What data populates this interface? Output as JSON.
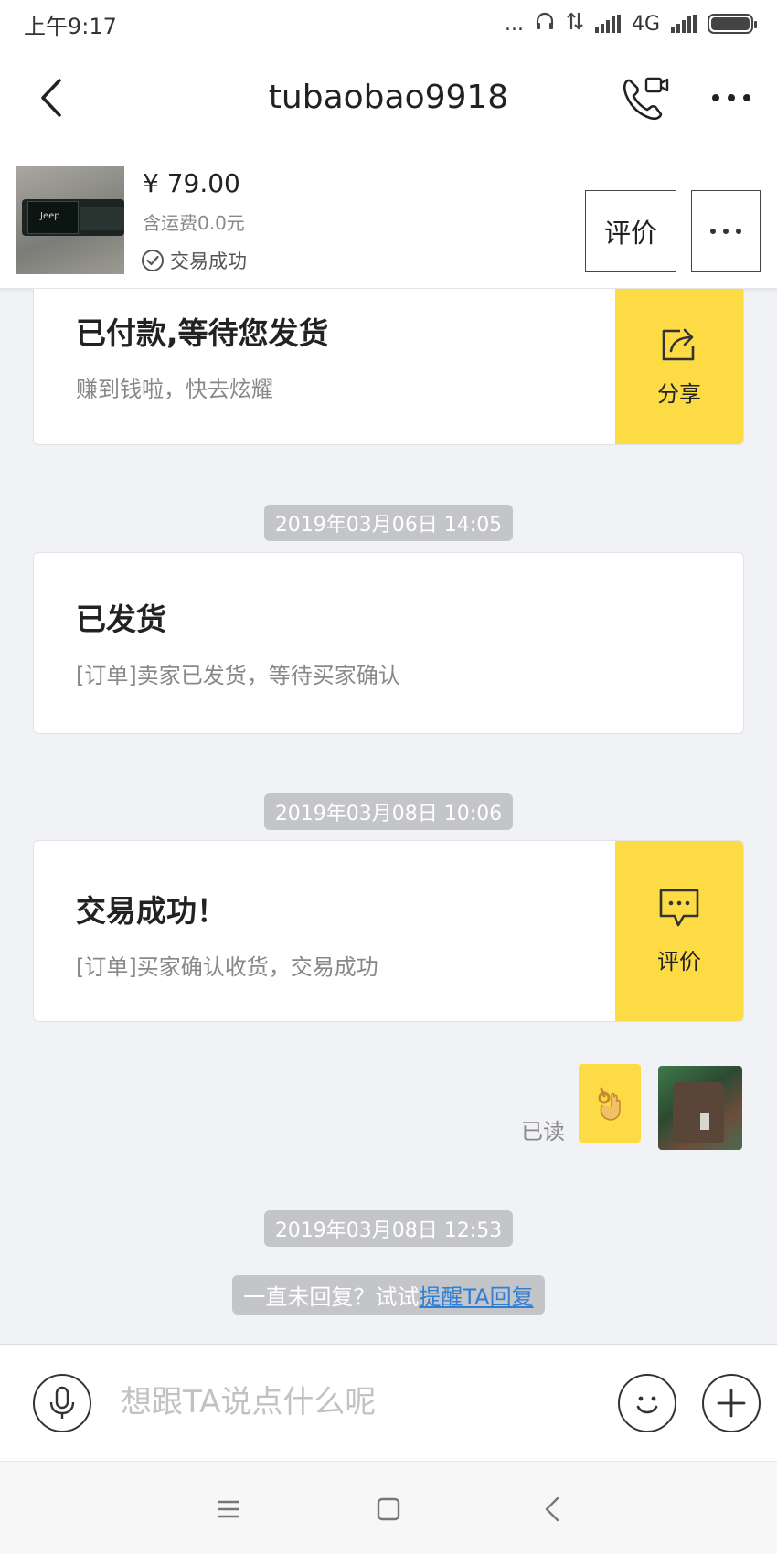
{
  "status_bar": {
    "time": "上午9:17",
    "network": "4G",
    "dots": "..."
  },
  "header": {
    "title": "tubaobao9918",
    "icons": [
      "back-arrow-icon",
      "video-call-icon",
      "more-icon"
    ]
  },
  "product": {
    "price": "¥ 79.00",
    "shipping": "含运费0.0元",
    "status": "交易成功",
    "review_button": "评价",
    "thumb_logo": "Jeep"
  },
  "messages": [
    {
      "title": "已付款,等待您发货",
      "subtitle": "赚到钱啦，快去炫耀",
      "action_label": "分享",
      "action_icon": "share-icon"
    },
    {
      "timestamp": "2019年03月06日 14:05",
      "title": "已发货",
      "subtitle": "[订单]卖家已发货，等待买家确认"
    },
    {
      "timestamp": "2019年03月08日 10:06",
      "title": "交易成功！",
      "subtitle": "[订单]买家确认收货，交易成功",
      "action_label": "评价",
      "action_icon": "comment-icon"
    }
  ],
  "sent_message": {
    "read_status": "已读",
    "content_icon": "ok-hand-emoji"
  },
  "final_timestamp": "2019年03月08日 12:53",
  "reminder": {
    "prefix": "一直未回复？试试",
    "link": "提醒TA回复"
  },
  "input": {
    "placeholder": "想跟TA说点什么呢"
  },
  "colors": {
    "accent_yellow": "#fddb45",
    "link_blue": "#2f7fd6",
    "background": "#f0f2f5"
  }
}
